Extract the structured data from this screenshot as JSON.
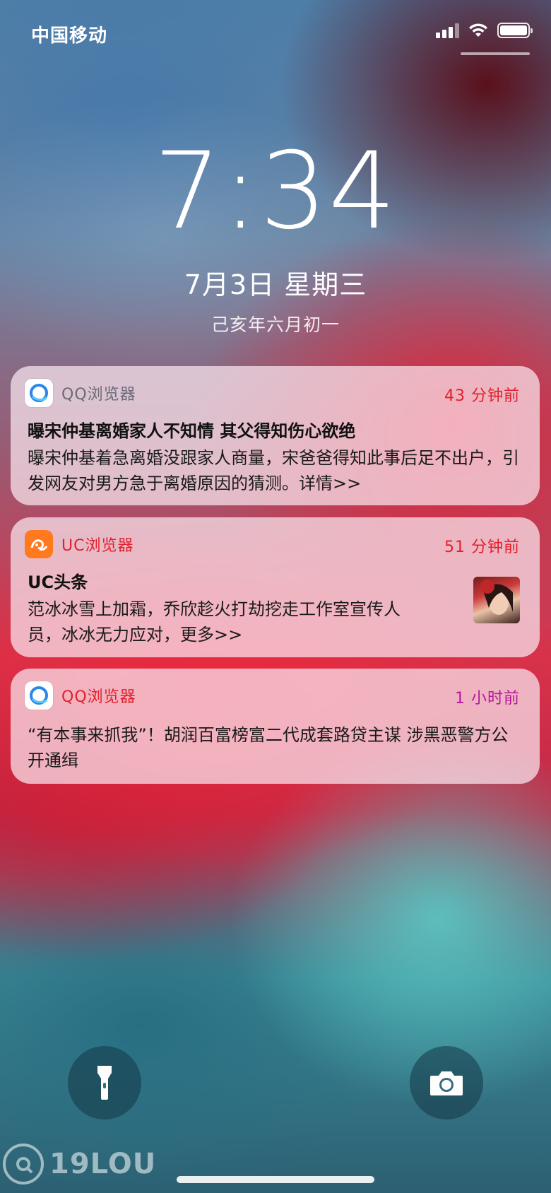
{
  "status_bar": {
    "carrier": "中国移动",
    "signal_bars": 4,
    "signal_active": 3,
    "icons": [
      "signal-icon",
      "wifi-icon",
      "battery-icon"
    ]
  },
  "lock_screen": {
    "time": "7:34",
    "date": "7月3日 星期三",
    "lunar_date": "己亥年六月初一"
  },
  "notifications": [
    {
      "app": "QQ浏览器",
      "time": "43 分钟前",
      "title": "曝宋仲基离婚家人不知情 其父得知伤心欲绝",
      "body": "曝宋仲基着急离婚没跟家人商量，宋爸爸得知此事后足不出户，引发网友对男方急于离婚原因的猜测。详情>>"
    },
    {
      "app": "UC浏览器",
      "time": "51 分钟前",
      "title": "UC头条",
      "body": "范冰冰雪上加霜，乔欣趁火打劫挖走工作室宣传人员，冰冰无力应对，更多>>",
      "has_thumbnail": true
    },
    {
      "app": "QQ浏览器",
      "time": "1 小时前",
      "body": "“有本事来抓我”！胡润百富榜富二代成套路贷主谋 涉黑恶警方公开通缉"
    }
  ],
  "bottom_controls": {
    "left": "flashlight-icon",
    "right": "camera-icon"
  },
  "watermark": {
    "text": "19LOU"
  },
  "colors": {
    "time_red": "#e2202c",
    "time_magenta": "#b5179e",
    "uc_orange": "#ff7a1e",
    "qq_blue": "#2a86e8"
  }
}
